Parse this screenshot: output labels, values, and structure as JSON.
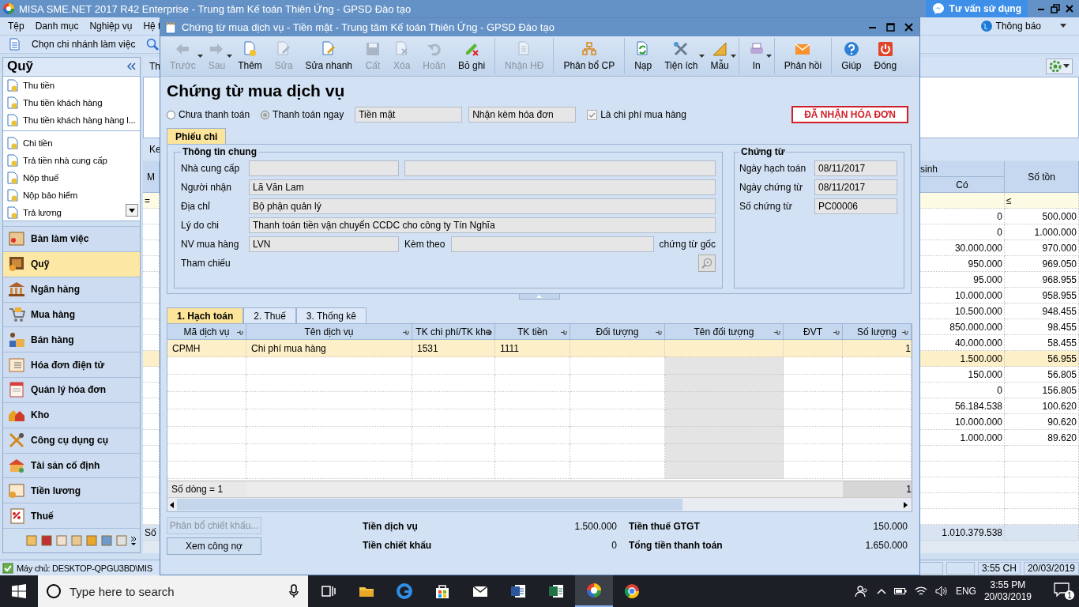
{
  "app": {
    "title": "MISA SME.NET 2017 R42 Enterprise - Trung tâm Kế toán Thiên Ứng - GPSD Đào tạo",
    "support_button": "Tư vấn sử dụng",
    "notification": "Thông báo",
    "menu": [
      "Tệp",
      "Danh mục",
      "Nghiệp vụ",
      "Hệ t"
    ],
    "branch": "Chọn chi nhánh làm việc"
  },
  "sidebar": {
    "title": "Quỹ",
    "groups": [
      [
        "Thu tiền",
        "Thu tiền khách hàng",
        "Thu tiền khách hàng hàng l..."
      ],
      [
        "Chi tiền",
        "Trả tiền nhà cung cấp",
        "Nộp thuế",
        "Nộp bảo hiểm",
        "Trả lương"
      ]
    ],
    "modules": [
      {
        "label": "Bàn làm việc",
        "selected": false
      },
      {
        "label": "Quỹ",
        "selected": true
      },
      {
        "label": "Ngân hàng",
        "selected": false
      },
      {
        "label": "Mua hàng",
        "selected": false
      },
      {
        "label": "Bán hàng",
        "selected": false
      },
      {
        "label": "Hóa đơn điện tử",
        "selected": false
      },
      {
        "label": "Quản lý hóa đơn",
        "selected": false
      },
      {
        "label": "Kho",
        "selected": false
      },
      {
        "label": "Công cụ dụng cụ",
        "selected": false
      },
      {
        "label": "Tài sản cố định",
        "selected": false
      },
      {
        "label": "Tiền lương",
        "selected": false
      },
      {
        "label": "Thuế",
        "selected": false
      }
    ]
  },
  "workspace": {
    "tab": "Th",
    "section": "Ke",
    "table": {
      "column_1": "M",
      "filter_1": "=",
      "group_header": "sinh",
      "columns": [
        "Có",
        "Số tồn"
      ],
      "filter_2": "≤",
      "rows": [
        {
          "values": [
            "0",
            "500.000"
          ],
          "selected": false
        },
        {
          "values": [
            "0",
            "1.000.000"
          ],
          "selected": false
        },
        {
          "values": [
            "30.000.000",
            "970.000"
          ],
          "selected": false
        },
        {
          "values": [
            "950.000",
            "969.050"
          ],
          "selected": false
        },
        {
          "values": [
            "95.000",
            "968.955"
          ],
          "selected": false
        },
        {
          "values": [
            "10.000.000",
            "958.955"
          ],
          "selected": false
        },
        {
          "values": [
            "10.500.000",
            "948.455"
          ],
          "selected": false
        },
        {
          "values": [
            "850.000.000",
            "98.455"
          ],
          "selected": false
        },
        {
          "values": [
            "40.000.000",
            "58.455"
          ],
          "selected": false
        },
        {
          "values": [
            "1.500.000",
            "56.955"
          ],
          "selected": true
        },
        {
          "values": [
            "150.000",
            "56.805"
          ],
          "selected": false
        },
        {
          "values": [
            "0",
            "156.805"
          ],
          "selected": false
        },
        {
          "values": [
            "56.184.538",
            "100.620"
          ],
          "selected": false
        },
        {
          "values": [
            "10.000.000",
            "90.620"
          ],
          "selected": false
        },
        {
          "values": [
            "1.000.000",
            "89.620"
          ],
          "selected": false
        }
      ],
      "total_label": "Số",
      "total": "1.010.379.538"
    }
  },
  "status_bar": {
    "server": "Máy chủ: DESKTOP-QPGU3BD\\MIS",
    "time": "3:55 CH",
    "date": "20/03/2019"
  },
  "dialog": {
    "title": "Chứng từ mua dịch vụ - Tiền mặt - Trung tâm Kế toán Thiên Ứng - GPSD Đào tạo",
    "toolbar": [
      {
        "label": "Trước",
        "disabled": true,
        "dropdown": true,
        "group_start": false
      },
      {
        "label": "Sau",
        "disabled": true,
        "dropdown": true,
        "group_start": false
      },
      {
        "label": "Thêm",
        "disabled": false,
        "dropdown": false,
        "group_start": false
      },
      {
        "label": "Sửa",
        "disabled": true,
        "dropdown": false,
        "group_start": false
      },
      {
        "label": "Sửa nhanh",
        "disabled": false,
        "dropdown": false,
        "group_start": false
      },
      {
        "label": "Cất",
        "disabled": true,
        "dropdown": false,
        "group_start": false
      },
      {
        "label": "Xóa",
        "disabled": true,
        "dropdown": false,
        "group_start": false
      },
      {
        "label": "Hoãn",
        "disabled": true,
        "dropdown": false,
        "group_start": false
      },
      {
        "label": "Bỏ ghi",
        "disabled": false,
        "dropdown": false,
        "group_start": false
      },
      {
        "label": "Nhận HĐ",
        "disabled": true,
        "dropdown": false,
        "group_start": true
      },
      {
        "label": "Phân bổ CP",
        "disabled": false,
        "dropdown": false,
        "group_start": true
      },
      {
        "label": "Nạp",
        "disabled": false,
        "dropdown": false,
        "group_start": true
      },
      {
        "label": "Tiện ích",
        "disabled": false,
        "dropdown": true,
        "group_start": false
      },
      {
        "label": "Mẫu",
        "disabled": false,
        "dropdown": true,
        "group_start": false
      },
      {
        "label": "In",
        "disabled": false,
        "dropdown": true,
        "group_start": true
      },
      {
        "label": "Phản hồi",
        "disabled": false,
        "dropdown": false,
        "group_start": true
      },
      {
        "label": "Giúp",
        "disabled": false,
        "dropdown": false,
        "group_start": true
      },
      {
        "label": "Đóng",
        "disabled": false,
        "dropdown": false,
        "group_start": false
      }
    ],
    "heading": "Chứng từ mua dịch vụ",
    "payment": [
      {
        "label": "Chưa thanh toán",
        "selected": false
      },
      {
        "label": "Thanh toán ngay",
        "selected": true
      }
    ],
    "payment_method": "Tiền mặt",
    "invoice_mode": "Nhận kèm hóa đơn",
    "purchase_cost": {
      "label": "Là chi phí mua hàng",
      "checked": true
    },
    "invoice_status": "ĐÃ NHẬN HÓA ĐƠN",
    "form_tabs": [
      {
        "label": "Phiếu chi",
        "selected": true
      }
    ],
    "general": {
      "title": "Thông tin chung",
      "fields": [
        {
          "kind": "pair",
          "label": "Nhà cung cấp"
        },
        {
          "kind": "text",
          "label": "Người nhận",
          "value": "Lã Văn Lam"
        },
        {
          "kind": "text",
          "label": "Địa chỉ",
          "value": "Bộ phận quản lý"
        },
        {
          "kind": "text",
          "label": "Lý do chi",
          "value": "Thanh toán tiền vận chuyển CCDC cho công ty Tín Nghĩa"
        },
        {
          "kind": "attach",
          "label": "NV mua hàng",
          "value": "LVN",
          "attach_label": "Kèm theo",
          "suffix": "chứng từ gốc"
        },
        {
          "kind": "reference",
          "label": "Tham chiếu"
        }
      ]
    },
    "voucher": {
      "title": "Chứng từ",
      "fields": [
        {
          "label": "Ngày hạch toán",
          "value": "08/11/2017"
        },
        {
          "label": "Ngày chứng từ",
          "value": "08/11/2017"
        },
        {
          "label": "Số chứng từ",
          "value": "PC00006"
        }
      ]
    },
    "detail_tabs": [
      {
        "label": "1. Hạch toán",
        "selected": true
      },
      {
        "label": "2. Thuế",
        "selected": false
      },
      {
        "label": "3. Thống kê",
        "selected": false
      }
    ],
    "grid": {
      "columns": [
        {
          "label": "Mã dịch vụ",
          "readonly": false
        },
        {
          "label": "Tên dịch vụ",
          "readonly": false
        },
        {
          "label": "TK chi phí/TK kho",
          "readonly": false
        },
        {
          "label": "TK tiền",
          "readonly": false
        },
        {
          "label": "Đối tượng",
          "readonly": false
        },
        {
          "label": "Tên đối tượng",
          "readonly": true
        },
        {
          "label": "ĐVT",
          "readonly": false
        },
        {
          "label": "Số lượng",
          "readonly": false
        }
      ],
      "rows": [
        {
          "service_code": "CPMH",
          "service_name": "Chi phí mua hàng",
          "expense_account": "1531",
          "cash_account": "1111",
          "quantity": "1",
          "selected": true
        }
      ],
      "row_count": "Số dòng = 1",
      "quantity_total": "1"
    },
    "buttons": [
      {
        "label": "Phân bổ chiết khấu...",
        "disabled": true
      },
      {
        "label": "Xem công nợ",
        "disabled": false
      }
    ],
    "totals": [
      {
        "label": "Tiền dịch vụ",
        "value": "1.500.000"
      },
      {
        "label": "Tiền thuế GTGT",
        "value": "150.000"
      },
      {
        "label": "Tiền chiết khấu",
        "value": "0"
      },
      {
        "label": "Tổng tiền thanh toán",
        "value": "1.650.000"
      }
    ]
  },
  "taskbar": {
    "search_placeholder": "Type here to search",
    "apps": [
      {
        "selected": false
      },
      {
        "selected": false
      },
      {
        "selected": false
      },
      {
        "selected": false
      },
      {
        "selected": false
      },
      {
        "selected": false
      },
      {
        "selected": false
      },
      {
        "selected": true
      },
      {
        "selected": false
      }
    ],
    "language": "ENG",
    "time": "3:55 PM",
    "date": "20/03/2019",
    "notifications": "1"
  }
}
